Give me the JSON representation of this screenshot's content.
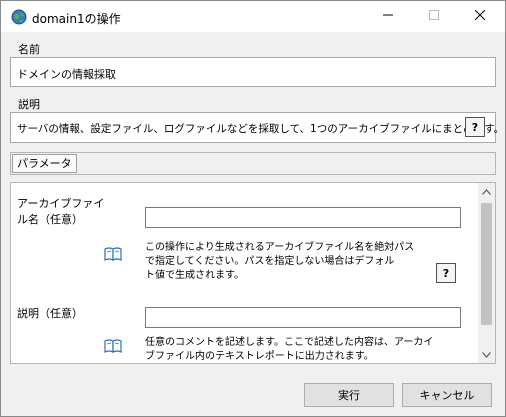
{
  "window": {
    "title": "domain1の操作",
    "icons": {
      "app": "globe-icon",
      "minimize": "minimize-icon",
      "maximize": "maximize-icon",
      "close": "close-icon"
    }
  },
  "name_group": {
    "label": "名前",
    "value": "ドメインの情報採取"
  },
  "description_group": {
    "label": "説明",
    "value": "サーバの情報、設定ファイル、ログファイルなどを採取して、1つのアーカイブファイルにまとめます。",
    "help_label": "?"
  },
  "parameters": {
    "tab_label": "パラメータ",
    "items": [
      {
        "label_lines": [
          "アーカイブファイ",
          "ル名（任意）"
        ],
        "value": "",
        "icon": "book-icon",
        "description_lines": [
          "この操作により生成されるアーカイブファイル名を絶対パス",
          "で指定してください。パスを指定しない場合はデフォル",
          "ト値で生成されます。"
        ],
        "help_label": "?"
      },
      {
        "label_lines": [
          "説明（任意）"
        ],
        "value": "",
        "icon": "book-icon",
        "description_lines": [
          "任意のコメントを記述します。ここで記述した内容は、アーカイ",
          "ブファイル内のテキストレポートに出力されます。"
        ]
      }
    ]
  },
  "buttons": {
    "execute": "実行",
    "cancel": "キャンセル"
  }
}
